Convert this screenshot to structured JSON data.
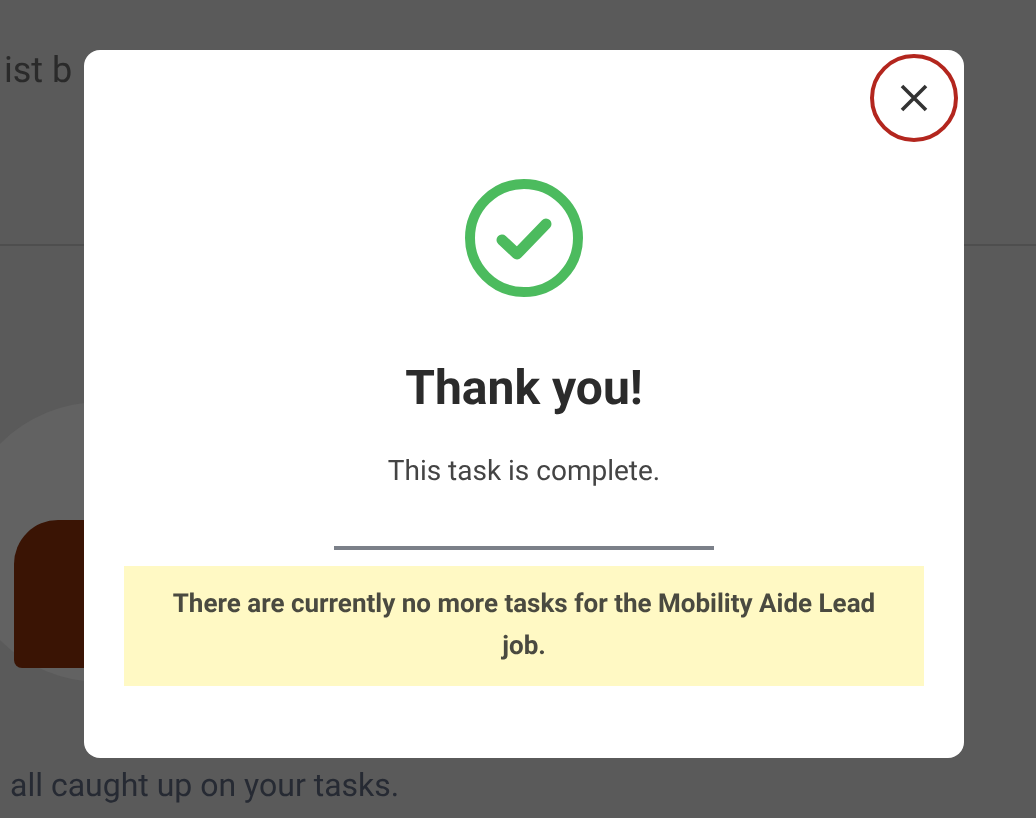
{
  "background": {
    "heading_fragment": "ist b",
    "footer_fragment": "all caught up on your tasks."
  },
  "dialog": {
    "title": "Thank you!",
    "message": "This task is complete.",
    "notice": "There are currently no more tasks for the Mobility Aide Lead job."
  }
}
